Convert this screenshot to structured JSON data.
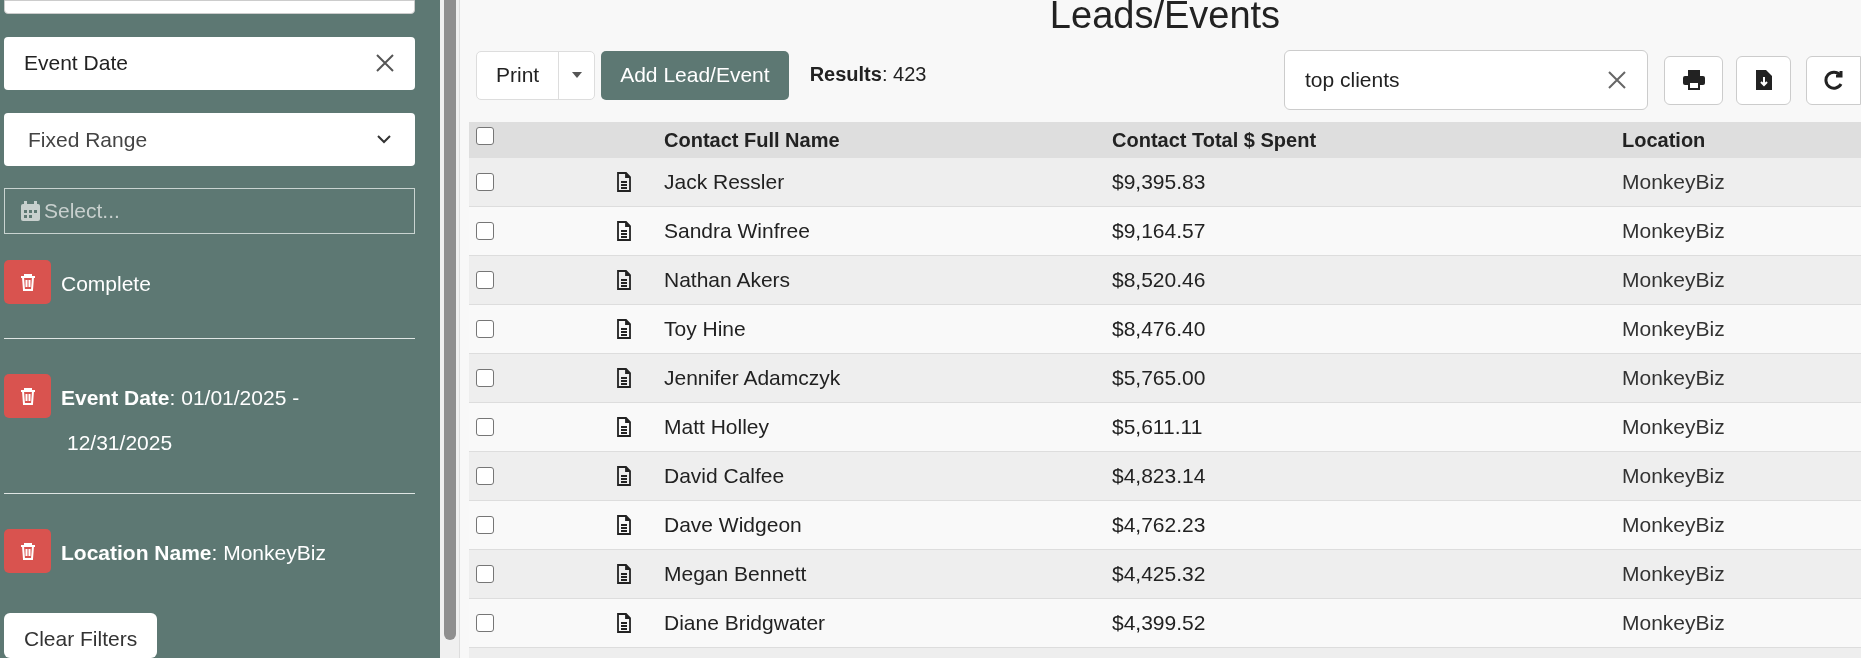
{
  "sidebar": {
    "field_select": {
      "value": "Event Date"
    },
    "range_select": {
      "value": "Fixed Range"
    },
    "date_field": {
      "placeholder": "Select..."
    },
    "filters": [
      {
        "text": "Complete"
      },
      {
        "text": "**Event Date**: 01/01/2025 -",
        "text_line_2": "12/31/2025"
      },
      {
        "text": "**Location Name**: MonkeyBiz"
      }
    ],
    "clear_button": "Clear Filters"
  },
  "title": "Leads/Events",
  "toolbar": {
    "print_button": "Print",
    "add_button": "Add Lead/Event",
    "results": "**Results**: 423",
    "search": {
      "value": "top clients"
    }
  },
  "table": {
    "header_checked": false,
    "columns": [
      "Contact Full Name",
      "Contact Total $ Spent",
      "Location"
    ],
    "rows": [
      {
        "checked": false,
        "name": "Jack Ressler",
        "spent": "$9,395.83",
        "location": "MonkeyBiz"
      },
      {
        "checked": false,
        "name": "Sandra Winfree",
        "spent": "$9,164.57",
        "location": "MonkeyBiz"
      },
      {
        "checked": false,
        "name": "Nathan Akers",
        "spent": "$8,520.46",
        "location": "MonkeyBiz"
      },
      {
        "checked": false,
        "name": "Toy Hine",
        "spent": "$8,476.40",
        "location": "MonkeyBiz"
      },
      {
        "checked": false,
        "name": "Jennifer Adamczyk",
        "spent": "$5,765.00",
        "location": "MonkeyBiz"
      },
      {
        "checked": false,
        "name": "Matt Holley",
        "spent": "$5,611.11",
        "location": "MonkeyBiz"
      },
      {
        "checked": false,
        "name": "David Calfee",
        "spent": "$4,823.14",
        "location": "MonkeyBiz"
      },
      {
        "checked": false,
        "name": "Dave Widgeon",
        "spent": "$4,762.23",
        "location": "MonkeyBiz"
      },
      {
        "checked": false,
        "name": "Megan Bennett",
        "spent": "$4,425.32",
        "location": "MonkeyBiz"
      },
      {
        "checked": false,
        "name": "Diane Bridgwater",
        "spent": "$4,399.52",
        "location": "MonkeyBiz"
      }
    ]
  }
}
